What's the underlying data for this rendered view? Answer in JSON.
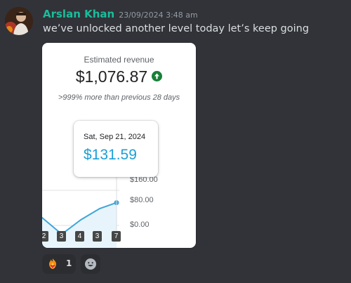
{
  "message": {
    "author": "Arslan Khan",
    "author_color": "#1abc9c",
    "timestamp": "23/09/2024 3:48 am",
    "text": "we’ve unlocked another level today let’s keep going"
  },
  "card": {
    "title": "Estimated revenue",
    "value": "$1,076.87",
    "trend_icon": "arrow-up-icon",
    "comparison": ">999% more than previous 28 days",
    "tooltip": {
      "date": "Sat, Sep 21, 2024",
      "value": "$131.59"
    },
    "y_axis_labels": [
      "$160.00",
      "$80.00",
      "$0.00"
    ],
    "x_tick_labels": [
      "2",
      "3",
      "4",
      "3",
      "7"
    ],
    "chart_data": {
      "type": "area",
      "ylim": [
        0,
        160
      ],
      "values": [
        80,
        90,
        97,
        59,
        92,
        118,
        131.59
      ]
    }
  },
  "reactions": [
    {
      "emoji": "fire-heart-icon",
      "count": "1"
    }
  ],
  "add_reaction_icon": "smiley-add-icon"
}
